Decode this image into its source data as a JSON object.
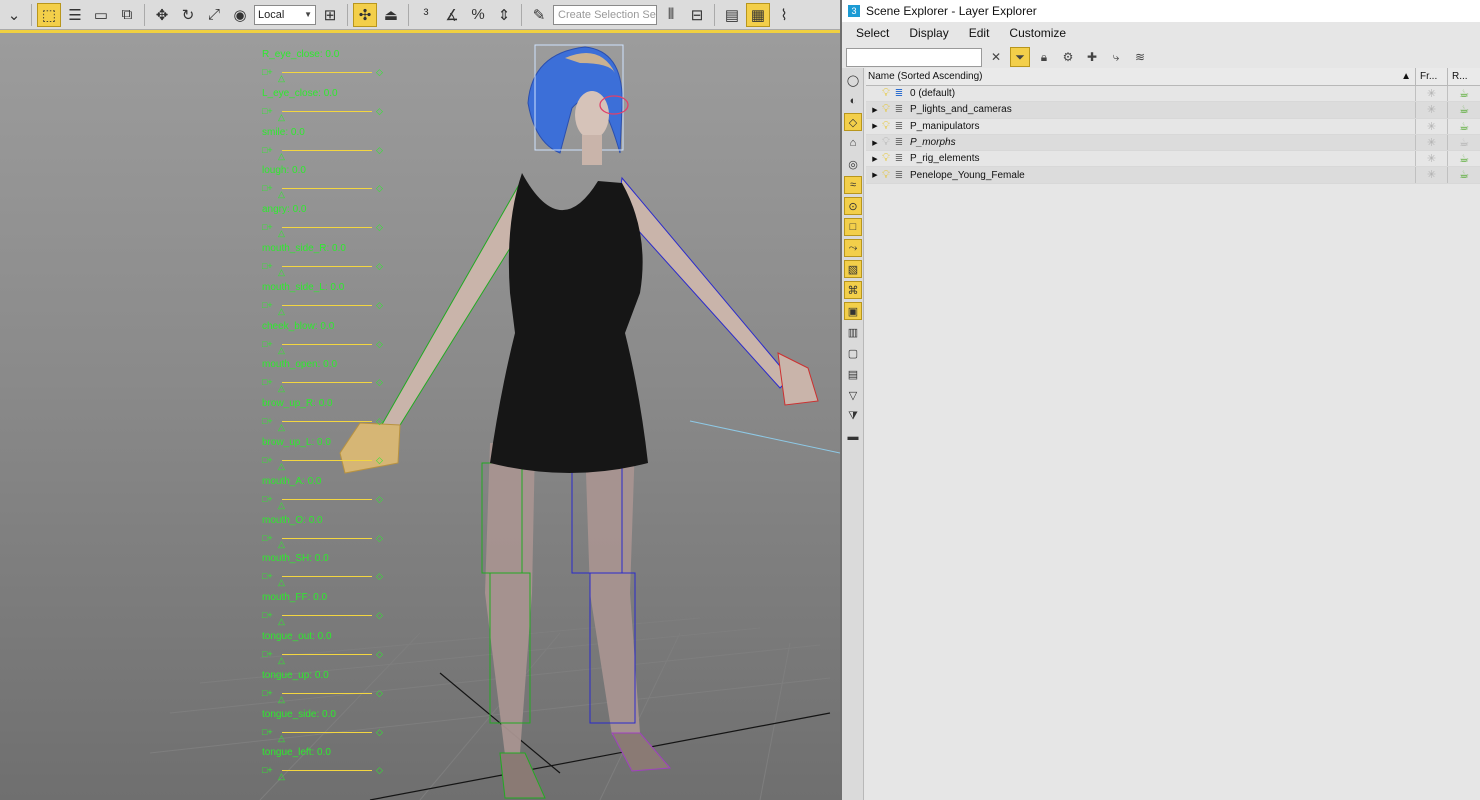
{
  "toolbar": {
    "coord_system": "Local",
    "selection_set_placeholder": "Create Selection Se",
    "icons": [
      "dropdown-icon",
      "select-object-icon",
      "select-by-name-icon",
      "rectangular-region-icon",
      "window-crossing-icon",
      "move-icon",
      "rotate-icon",
      "scale-icon",
      "snap-sphere-icon",
      "pivot-icon",
      "select-link-icon",
      "snaps-toggle-icon",
      "angle-snap-icon",
      "percent-snap-icon",
      "spinner-snap-icon",
      "edit-named-sets-icon",
      "mirror-icon",
      "align-icon",
      "toggle-layer-icon",
      "toggle-explorer-icon",
      "curve-editor-icon"
    ]
  },
  "viewport": {
    "morph_sliders": [
      {
        "label": "R_eye_close: 0.0"
      },
      {
        "label": "L_eye_close: 0.0"
      },
      {
        "label": "smile: 0.0"
      },
      {
        "label": "lough: 0.0"
      },
      {
        "label": "angry: 0.0"
      },
      {
        "label": "mouth_side_R: 0.0"
      },
      {
        "label": "mouth_side_L: 0.0"
      },
      {
        "label": "cheek_blow: 0.0"
      },
      {
        "label": "mouth_open: 0.0"
      },
      {
        "label": "brow_up_R: 0.0"
      },
      {
        "label": "brow_up_L: 0.0"
      },
      {
        "label": "mouth_A: 0.0"
      },
      {
        "label": "mouth_O: 0.0"
      },
      {
        "label": "mouth_SH: 0.0"
      },
      {
        "label": "mouth_FF: 0.0"
      },
      {
        "label": "tongue_out: 0.0"
      },
      {
        "label": "tongue_up: 0.0"
      },
      {
        "label": "tongue_side: 0.0"
      },
      {
        "label": "tongue_left: 0.0"
      }
    ],
    "colors": {
      "morph_text": "#2eea2e",
      "morph_track": "#f3d640",
      "dress": "#161616",
      "skin": "#c9b4aa",
      "bone_left": "#22aa22",
      "bone_right": "#2a2acc"
    }
  },
  "explorer": {
    "title": "Scene Explorer - Layer Explorer",
    "menu": [
      "Select",
      "Display",
      "Edit",
      "Customize"
    ],
    "columns": {
      "name": "Name (Sorted Ascending)",
      "frozen": "Fr...",
      "render": "R..."
    },
    "layers": [
      {
        "name": "0 (default)",
        "expandable": false,
        "hidden": false,
        "current": true,
        "italic": false,
        "renderable": true
      },
      {
        "name": "P_lights_and_cameras",
        "expandable": true,
        "hidden": false,
        "current": false,
        "italic": false,
        "renderable": true
      },
      {
        "name": "P_manipulators",
        "expandable": true,
        "hidden": false,
        "current": false,
        "italic": false,
        "renderable": true
      },
      {
        "name": "P_morphs",
        "expandable": true,
        "hidden": true,
        "current": false,
        "italic": true,
        "renderable": false
      },
      {
        "name": "P_rig_elements",
        "expandable": true,
        "hidden": false,
        "current": false,
        "italic": false,
        "renderable": true
      },
      {
        "name": "Penelope_Young_Female",
        "expandable": true,
        "hidden": false,
        "current": false,
        "italic": false,
        "renderable": true
      }
    ]
  }
}
